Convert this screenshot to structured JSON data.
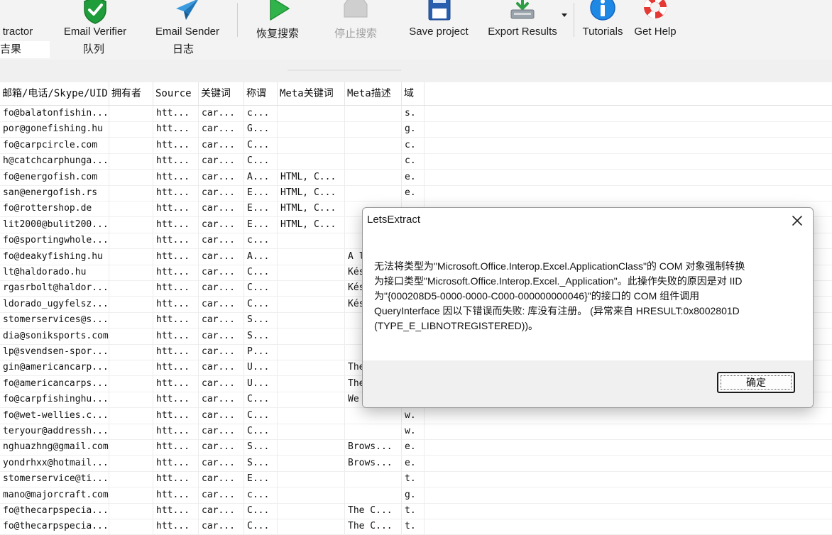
{
  "toolbar": {
    "items": [
      {
        "label": "tractor",
        "icon": "key-icon"
      },
      {
        "label": "Email Verifier",
        "icon": "green-shield-check-icon"
      },
      {
        "label": "Email Sender",
        "icon": "paper-plane-icon"
      },
      {
        "label": "恢复搜索",
        "icon": "play-icon"
      },
      {
        "label": "停止搜索",
        "icon": "stop-icon"
      },
      {
        "label": "Save project",
        "icon": "floppy-disk-icon"
      },
      {
        "label": "Export Results",
        "icon": "export-icon"
      },
      {
        "label": "Tutorials",
        "icon": "info-icon"
      },
      {
        "label": "Get Help",
        "icon": "lifebuoy-icon"
      }
    ],
    "subtabs": [
      "吉果",
      "队列",
      "日志"
    ]
  },
  "table": {
    "columns": [
      "邮箱/电话/Skype/UID",
      "拥有者",
      "Source",
      "关键词",
      "称谓",
      "Meta关键词",
      "Meta描述",
      "域"
    ],
    "rows": [
      [
        "fo@balatonfishin...",
        "",
        "htt...",
        "car...",
        "c...",
        "",
        "",
        "s."
      ],
      [
        "por@gonefishing.hu",
        "",
        "htt...",
        "car...",
        "G...",
        "",
        "",
        "g."
      ],
      [
        "fo@carpcircle.com",
        "",
        "htt...",
        "car...",
        "C...",
        "",
        "",
        "c."
      ],
      [
        "h@catchcarphunga...",
        "",
        "htt...",
        "car...",
        "C...",
        "",
        "",
        "c."
      ],
      [
        "fo@energofish.com",
        "",
        "htt...",
        "car...",
        "A...",
        "HTML, C...",
        "",
        "e."
      ],
      [
        "san@energofish.rs",
        "",
        "htt...",
        "car...",
        "E...",
        "HTML, C...",
        "",
        "e."
      ],
      [
        "fo@rottershop.de",
        "",
        "htt...",
        "car...",
        "E...",
        "HTML, C...",
        "",
        ""
      ],
      [
        "lit2000@bulit200...",
        "",
        "htt...",
        "car...",
        "E...",
        "HTML, C...",
        "",
        ""
      ],
      [
        "fo@sportingwhole...",
        "",
        "htt...",
        "car...",
        "c...",
        "",
        "",
        ""
      ],
      [
        "fo@deakyfishing.hu",
        "",
        "htt...",
        "car...",
        "A...",
        "",
        "A l",
        ""
      ],
      [
        "lt@haldorado.hu",
        "",
        "htt...",
        "car...",
        "C...",
        "",
        "Kés",
        ""
      ],
      [
        "rgasrbolt@haldor...",
        "",
        "htt...",
        "car...",
        "C...",
        "",
        "Kés",
        ""
      ],
      [
        "ldorado_ugyfelsz...",
        "",
        "htt...",
        "car...",
        "C...",
        "",
        "Kés",
        ""
      ],
      [
        "stomerservices@s...",
        "",
        "htt...",
        "car...",
        "S...",
        "",
        "",
        ""
      ],
      [
        "dia@soniksports.com",
        "",
        "htt...",
        "car...",
        "S...",
        "",
        "",
        ""
      ],
      [
        "lp@svendsen-spor...",
        "",
        "htt...",
        "car...",
        "P...",
        "",
        "",
        ""
      ],
      [
        "gin@americancarp...",
        "",
        "htt...",
        "car...",
        "U...",
        "",
        "The",
        ""
      ],
      [
        "fo@americancarps...",
        "",
        "htt...",
        "car...",
        "U...",
        "",
        "The",
        ""
      ],
      [
        "fo@carpfishinghu...",
        "",
        "htt...",
        "car...",
        "C...",
        "",
        "We",
        ""
      ],
      [
        "fo@wet-wellies.c...",
        "",
        "htt...",
        "car...",
        "C...",
        "",
        "",
        "w."
      ],
      [
        "teryour@addressh...",
        "",
        "htt...",
        "car...",
        "C...",
        "",
        "",
        "w."
      ],
      [
        "nghuazhng@gmail.com",
        "",
        "htt...",
        "car...",
        "S...",
        "",
        "Brows...",
        "e."
      ],
      [
        "yondrhxx@hotmail...",
        "",
        "htt...",
        "car...",
        "S...",
        "",
        "Brows...",
        "e."
      ],
      [
        "stomerservice@ti...",
        "",
        "htt...",
        "car...",
        "E...",
        "",
        "",
        "t."
      ],
      [
        "mano@majorcraft.com",
        "",
        "htt...",
        "car...",
        "c...",
        "",
        "",
        "g."
      ],
      [
        "fo@thecarpspecia...",
        "",
        "htt...",
        "car...",
        "C...",
        "",
        "The C...",
        "t."
      ],
      [
        "fo@thecarpspecia...",
        "",
        "htt...",
        "car...",
        "C...",
        "",
        "The C...",
        "t."
      ]
    ]
  },
  "dialog": {
    "title": "LetsExtract",
    "message_lines": [
      "无法将类型为\"Microsoft.Office.Interop.Excel.ApplicationClass\"的 COM 对象强制转换",
      "为接口类型\"Microsoft.Office.Interop.Excel._Application\"。此操作失败的原因是对 IID",
      "为\"{000208D5-0000-0000-C000-000000000046}\"的接口的 COM 组件调用",
      "QueryInterface 因以下错误而失败: 库没有注册。 (异常来自 HRESULT:0x8002801D",
      "(TYPE_E_LIBNOTREGISTERED))。"
    ],
    "ok_label": "确定"
  }
}
